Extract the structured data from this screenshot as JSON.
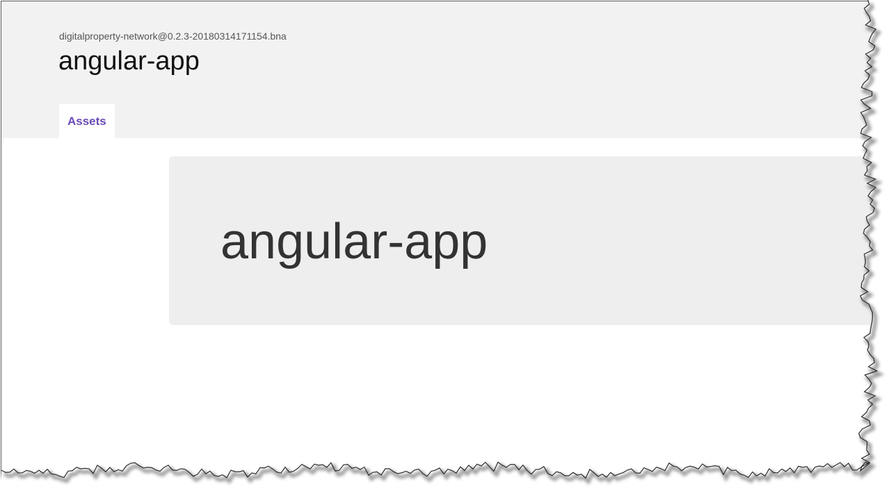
{
  "header": {
    "package_name": "digitalproperty-network@0.2.3-20180314171154.bna",
    "app_title": "angular-app"
  },
  "nav": {
    "tabs": [
      {
        "label": "Assets",
        "active": true
      }
    ]
  },
  "main": {
    "jumbotron_title": "angular-app"
  },
  "colors": {
    "header_background": "#f2f2f2",
    "tab_accent": "#6a4bb7",
    "jumbotron_background": "#eeeeee"
  }
}
